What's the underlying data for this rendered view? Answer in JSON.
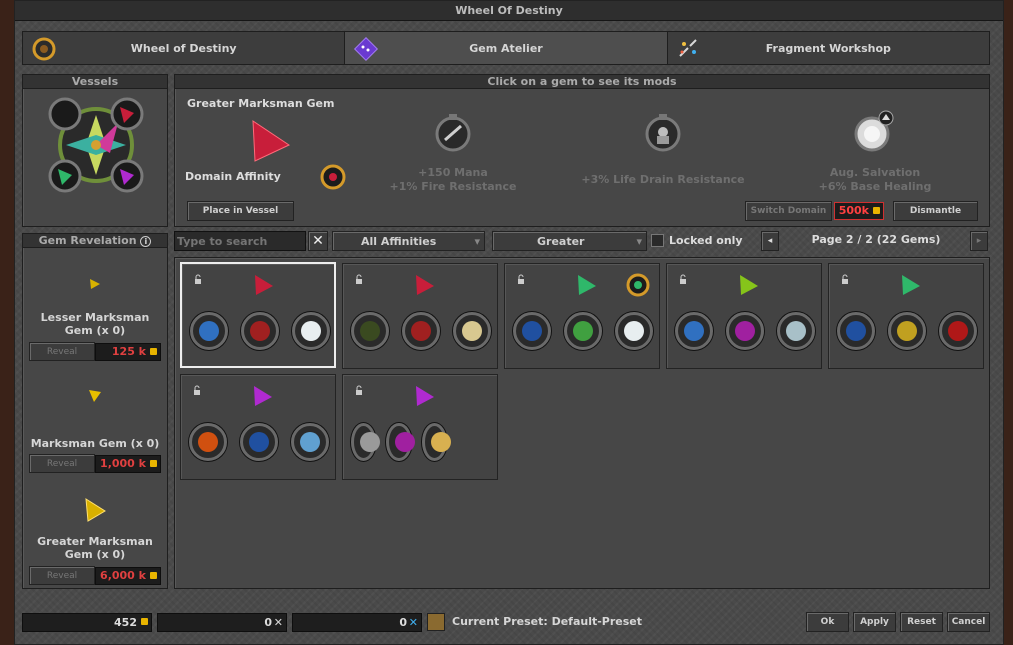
{
  "window": {
    "title": "Wheel Of Destiny"
  },
  "tabs": [
    {
      "label": "Wheel of Destiny",
      "icon": "wheel-icon"
    },
    {
      "label": "Gem Atelier",
      "icon": "gem-atelier-icon"
    },
    {
      "label": "Fragment Workshop",
      "icon": "fragment-icon"
    }
  ],
  "vessels": {
    "title": "Vessels"
  },
  "details": {
    "title": "Click on a gem to see its mods",
    "gem_name": "Greater Marksman Gem",
    "affinity_label": "Domain Affinity",
    "place_button": "Place in Vessel",
    "mod1": [
      "+150 Mana",
      "+1% Fire Resistance"
    ],
    "mod2": "+3% Life Drain Resistance",
    "mod3": [
      "Aug. Salvation",
      "+6% Base Healing"
    ],
    "switch_button": "Switch Domain",
    "switch_price": "500k",
    "dismantle_button": "Dismantle"
  },
  "revelation": {
    "title": "Gem Revelation",
    "info_icon": "info-icon",
    "reveal_label": "Reveal",
    "items": [
      {
        "name": "Lesser Marksman Gem (x 0)",
        "price": "125 k"
      },
      {
        "name": "Marksman Gem (x 0)",
        "price": "1,000 k"
      },
      {
        "name": "Greater Marksman Gem (x 0)",
        "price": "6,000 k"
      }
    ]
  },
  "filters": {
    "search_placeholder": "Type to search",
    "affinity": "All Affinities",
    "quality": "Greater",
    "locked_only": "Locked only",
    "page": "Page 2 / 2 (22 Gems)"
  },
  "colors": {
    "red": "#c81e3a",
    "green": "#2fb86a",
    "lime": "#86c41a",
    "purple": "#b02ad0"
  },
  "footer": {
    "gold": "452",
    "fragments1": "0",
    "fragments2": "0",
    "preset": "Current Preset: Default-Preset",
    "ok": "Ok",
    "apply": "Apply",
    "reset": "Reset",
    "cancel": "Cancel"
  }
}
